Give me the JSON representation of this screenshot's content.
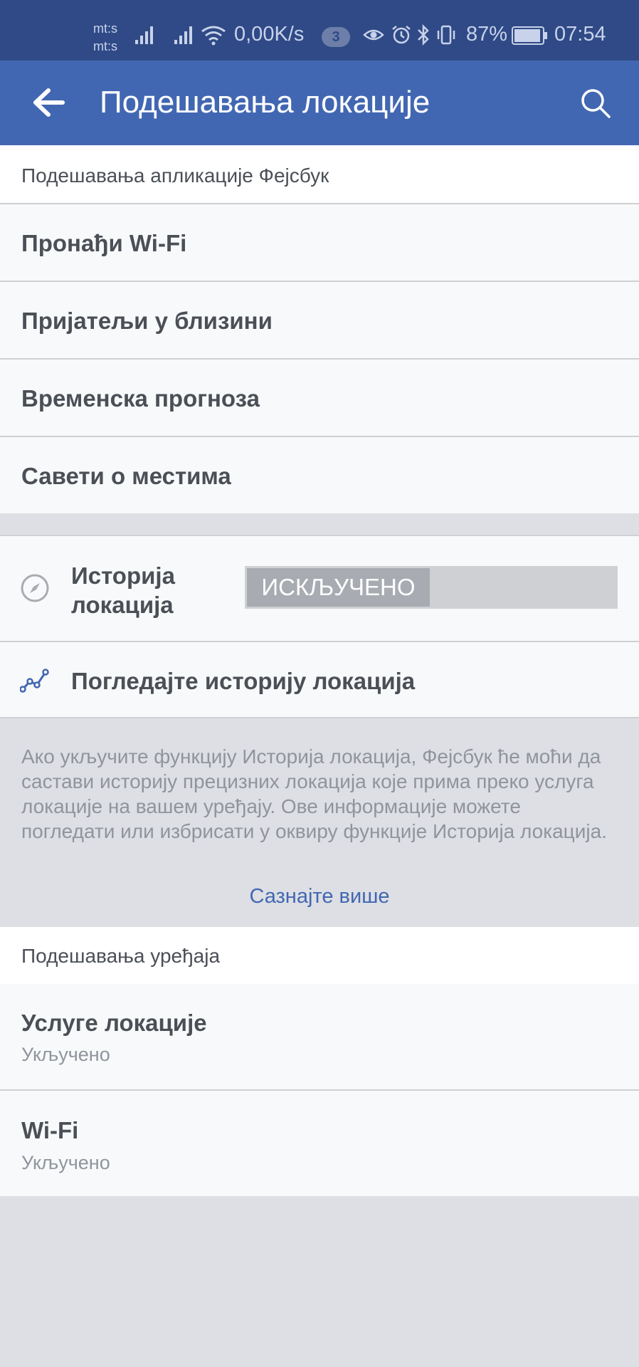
{
  "status_bar": {
    "carrier_top": "mt:s",
    "carrier_bottom": "mt:s",
    "speed": "0,00K/s",
    "notification_count": "3",
    "battery": "87%",
    "time": "07:54"
  },
  "app_bar": {
    "title": "Подешавања локације"
  },
  "app_section": {
    "header": "Подешавања апликације Фејсбук",
    "items": [
      {
        "label": "Пронађи Wi-Fi"
      },
      {
        "label": "Пријатељи у близини"
      },
      {
        "label": "Временска прогноза"
      },
      {
        "label": "Савети о местима"
      }
    ]
  },
  "history": {
    "label_line1": "Историја",
    "label_line2": "локација",
    "toggle_state": "ИСКЉУЧЕНО",
    "view_label": "Погледајте историју локација"
  },
  "info": {
    "text": "Ако укључите функцију Историја локација, Фејсбук ће моћи да састави историју прецизних локација које прима преко услуга локације на вашем уређају. Ове информације можете погледати или избрисати у оквиру функције Историја локација.",
    "learn_more": "Сазнајте више"
  },
  "device_section": {
    "header": "Подешавања уређаја",
    "items": [
      {
        "label": "Услуге локације",
        "status": "Укључено"
      },
      {
        "label": "Wi-Fi",
        "status": "Укључено"
      }
    ]
  },
  "colors": {
    "status_bar": "#2f4a86",
    "app_bar": "#4267b2",
    "accent": "#4267b2",
    "background": "#dddfe4"
  }
}
